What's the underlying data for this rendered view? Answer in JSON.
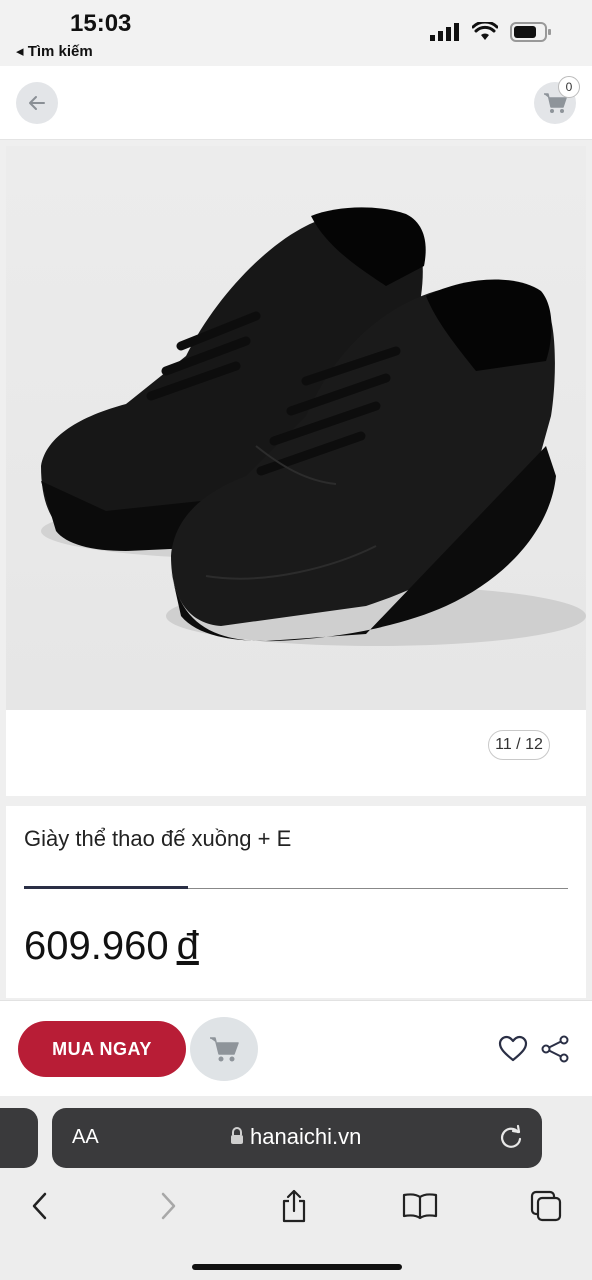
{
  "status_bar": {
    "time": "15:03",
    "back_label": "◂ Tìm kiếm",
    "icons": [
      "signal-icon",
      "wifi-icon",
      "battery-icon"
    ]
  },
  "header": {
    "back_icon": "arrow-left-icon",
    "cart_icon": "cart-icon",
    "cart_count": "0"
  },
  "gallery": {
    "image_alt": "black-sneakers",
    "counter": "11 / 12"
  },
  "product": {
    "title": "Giày thể thao đế xuồng + E",
    "price": "609.960",
    "currency": "đ"
  },
  "actions": {
    "buy_now_label": "MUA NGAY",
    "add_to_cart_icon": "cart-icon",
    "favorite_icon": "heart-icon",
    "share_icon": "share-icon"
  },
  "browser": {
    "aa_label": "AA",
    "url": "hanaichi.vn",
    "toolbar": [
      "back-icon",
      "forward-icon",
      "share-icon",
      "bookmarks-icon",
      "tabs-icon"
    ]
  },
  "colors": {
    "accent": "#b81d36",
    "tab_active": "#2a2f45",
    "url_bar": "#3a3a3c"
  }
}
